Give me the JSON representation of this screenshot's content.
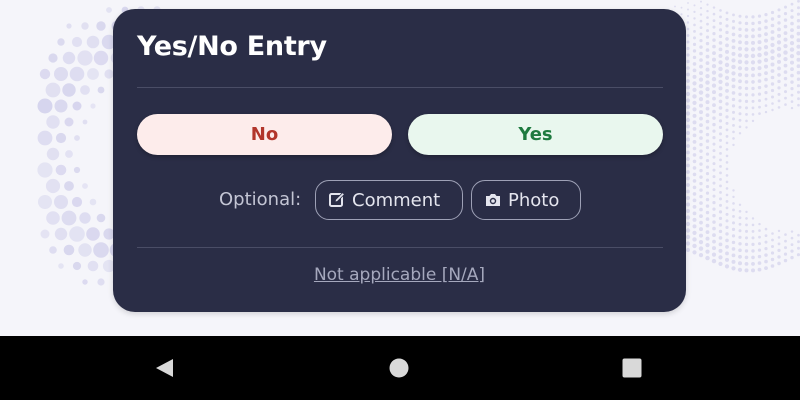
{
  "dialog": {
    "title": "Yes/No Entry",
    "no_label": "No",
    "yes_label": "Yes",
    "optional_label": "Optional:",
    "comment_label": "Comment",
    "photo_label": "Photo",
    "na_label": "Not applicable [N/A]"
  },
  "icons": {
    "comment": "edit-icon",
    "photo": "camera-icon",
    "back": "back-triangle-icon",
    "home": "home-circle-icon",
    "recents": "recents-square-icon"
  },
  "colors": {
    "card_bg": "#2a2d46",
    "no_bg": "#fdeceb",
    "no_text": "#b2352b",
    "yes_bg": "#e9f7ee",
    "yes_text": "#1e7a3f",
    "background_dots": "#c9c7e8"
  }
}
